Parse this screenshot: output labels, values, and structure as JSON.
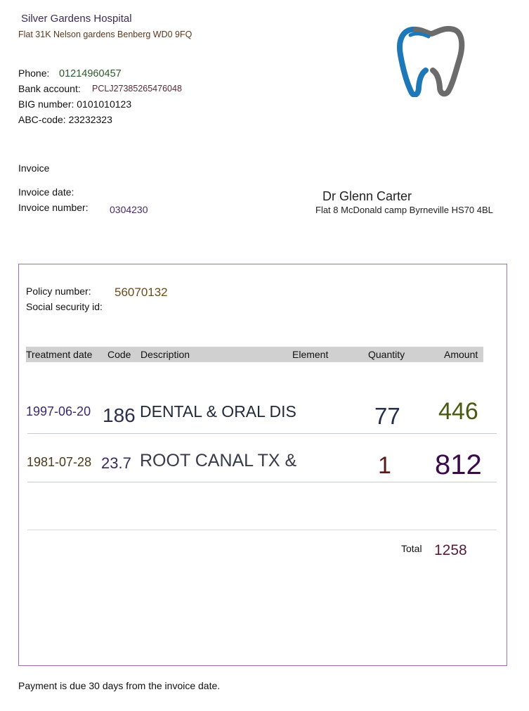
{
  "hospital": {
    "name": "Silver Gardens Hospital",
    "address": "Flat 31K Nelson gardens Benberg WD0 9FQ",
    "phone_label": "Phone:",
    "phone": "01214960457",
    "bank_label": "Bank account:",
    "bank": "PCLJ27385265476048",
    "big": "BIG number: 0101010123",
    "abc": "ABC-code: 23232323"
  },
  "invoice": {
    "title": "Invoice",
    "date_label": "Invoice date:",
    "number_label": "Invoice number:",
    "number": "0304230"
  },
  "recipient": {
    "name": "Dr Glenn Carter",
    "address": "Flat 8 McDonald camp Byrneville HS70 4BL"
  },
  "policy": {
    "policy_label": "Policy number:",
    "policy_number": "56070132",
    "ssid_label": "Social security id:"
  },
  "table": {
    "headers": [
      "Treatment date",
      "Code",
      "Description",
      "Element",
      "Quantity",
      "Amount"
    ],
    "rows": [
      {
        "date": "1997-06-20",
        "code": "186",
        "description": "DENTAL & ORAL DIS",
        "quantity": "77",
        "amount": "446"
      },
      {
        "date": "1981-07-28",
        "code": "23.7",
        "description": "ROOT CANAL TX &",
        "quantity": "1",
        "amount": "812"
      }
    ],
    "total_label": "Total",
    "total": "1258"
  },
  "footer": {
    "note": "Payment is due 30 days from the invoice date."
  },
  "colors": {
    "box_border": "#9b6fb6",
    "header_fill": "#d0d0d0",
    "tooth_blue": "#1e78b8",
    "tooth_grey": "#6b6b6b"
  },
  "icons": [
    "tooth-logo-icon"
  ]
}
